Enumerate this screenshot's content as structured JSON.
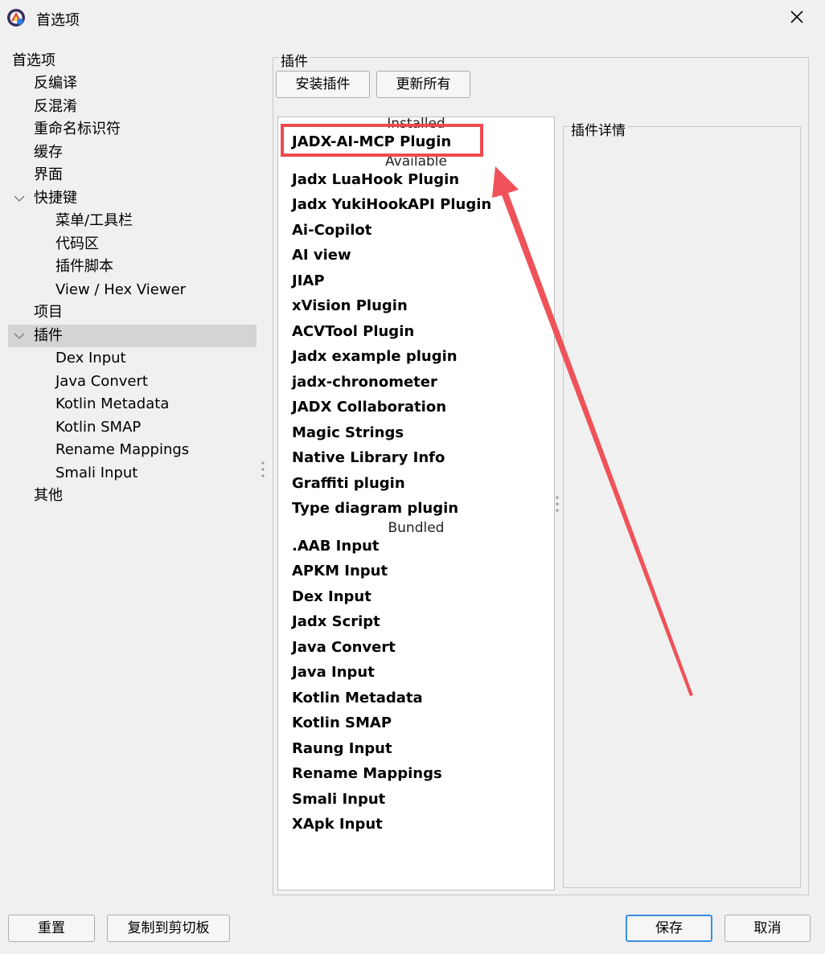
{
  "window": {
    "title": "首选项",
    "app_icon": "jadx-logo-icon",
    "close_icon": "close-icon"
  },
  "sidebar": {
    "items": [
      {
        "label": "首选项",
        "level": 0
      },
      {
        "label": "反编译",
        "level": 1
      },
      {
        "label": "反混淆",
        "level": 1
      },
      {
        "label": "重命名标识符",
        "level": 1
      },
      {
        "label": "缓存",
        "level": 1
      },
      {
        "label": "界面",
        "level": 1
      },
      {
        "label": "快捷键",
        "level": 1,
        "expanded": true
      },
      {
        "label": "菜单/工具栏",
        "level": 2
      },
      {
        "label": "代码区",
        "level": 2
      },
      {
        "label": "插件脚本",
        "level": 2
      },
      {
        "label": "View / Hex Viewer",
        "level": 2
      },
      {
        "label": "项目",
        "level": 1
      },
      {
        "label": "插件",
        "level": 1,
        "expanded": true,
        "selected": true
      },
      {
        "label": "Dex Input",
        "level": 2
      },
      {
        "label": "Java Convert",
        "level": 2
      },
      {
        "label": "Kotlin Metadata",
        "level": 2
      },
      {
        "label": "Kotlin SMAP",
        "level": 2
      },
      {
        "label": "Rename Mappings",
        "level": 2
      },
      {
        "label": "Smali Input",
        "level": 2
      },
      {
        "label": "其他",
        "level": 1
      }
    ]
  },
  "plugins_panel": {
    "title": "插件",
    "install_button": "安装插件",
    "update_all_button": "更新所有",
    "details_title": "插件详情",
    "sections": {
      "installed": {
        "header": "Installed",
        "items": [
          "JADX-AI-MCP Plugin"
        ]
      },
      "available": {
        "header": "Available",
        "items": [
          "Jadx LuaHook Plugin",
          "Jadx YukiHookAPI Plugin",
          "Ai-Copilot",
          "AI view",
          "JIAP",
          "xVision Plugin",
          "ACVTool Plugin",
          "Jadx example plugin",
          "jadx-chronometer",
          "JADX Collaboration",
          "Magic Strings",
          "Native Library Info",
          "Graffiti plugin",
          "Type diagram plugin"
        ]
      },
      "bundled": {
        "header": "Bundled",
        "items": [
          ".AAB Input",
          "APKM Input",
          "Dex Input",
          "Jadx Script",
          "Java Convert",
          "Java Input",
          "Kotlin Metadata",
          "Kotlin SMAP",
          "Raung Input",
          "Rename Mappings",
          "Smali Input",
          "XApk Input"
        ]
      }
    }
  },
  "footer": {
    "reset_button": "重置",
    "copy_button": "复制到剪切板",
    "save_button": "保存",
    "cancel_button": "取消"
  },
  "annotation": {
    "highlight_color": "#ef4a4f"
  }
}
